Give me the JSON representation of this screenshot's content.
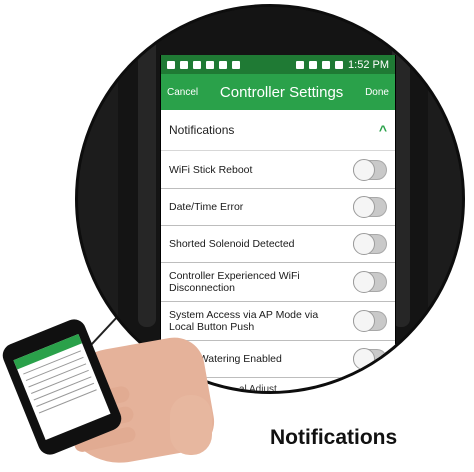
{
  "status_bar": {
    "time": "1:52 PM"
  },
  "header": {
    "cancel_label": "Cancel",
    "title": "Controller Settings",
    "done_label": "Done"
  },
  "section": {
    "title": "Notifications",
    "chevron": "^"
  },
  "rows": [
    {
      "label": "WiFi Stick Reboot",
      "enabled": false
    },
    {
      "label": "Date/Time Error",
      "enabled": false
    },
    {
      "label": "Shorted Solenoid Detected",
      "enabled": false
    },
    {
      "label": "Controller Experienced WiFi Disconnection",
      "enabled": false
    },
    {
      "label": "System Access via AP Mode via Local Button Push",
      "enabled": false
    },
    {
      "label": "Delay Watering Enabled",
      "enabled": false
    }
  ],
  "partial_row": {
    "label": "al Adjust"
  },
  "caption": "Notifications",
  "colors": {
    "accent": "#2aa14a",
    "status_bar": "#1f7a34"
  }
}
